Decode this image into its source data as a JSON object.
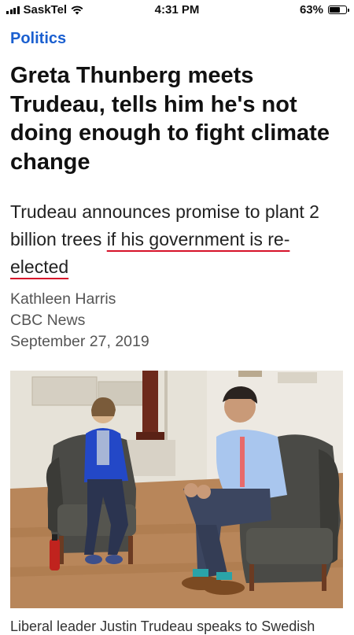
{
  "status_bar": {
    "carrier": "SaskTel",
    "time": "4:31 PM",
    "battery_percent": "63%",
    "battery_level": 0.63,
    "icons": [
      "signal-icon",
      "wifi-icon",
      "battery-icon"
    ]
  },
  "article": {
    "section": "Politics",
    "headline": "Greta Thunberg meets Trudeau, tells him he's not doing enough to fight climate change",
    "dek_plain": "Trudeau announces promise to plant 2 billion trees ",
    "dek_underlined": "if his government is re-elected",
    "author": "Kathleen Harris",
    "outlet": "CBC News",
    "date": "September 27, 2019",
    "caption": "Liberal leader Justin Trudeau speaks to Swedish"
  },
  "colors": {
    "section": "#1a5fd0",
    "underline": "#d6122a"
  }
}
